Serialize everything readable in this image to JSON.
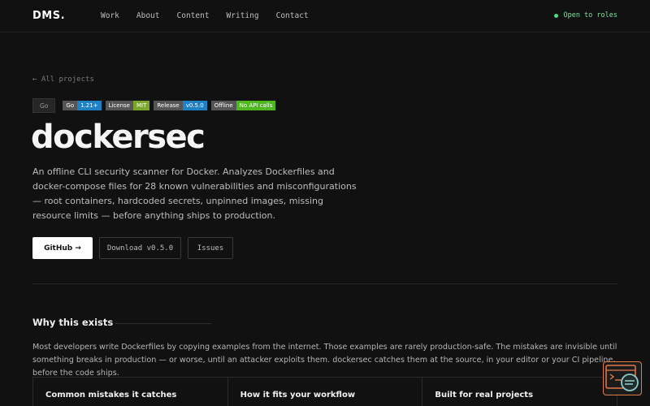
{
  "nav": {
    "logo": "DMS",
    "logo_dot": ".",
    "links": [
      "Work",
      "About",
      "Content",
      "Writing",
      "Contact"
    ],
    "status": "Open to roles"
  },
  "back_link": "← All projects",
  "badges": {
    "go_tag": "Go",
    "shields": [
      {
        "key": "Go",
        "value": "1.21+",
        "color": "#1f80c4"
      },
      {
        "key": "License",
        "value": "MIT",
        "color": "#7aa62c"
      },
      {
        "key": "Release",
        "value": "v0.5.0",
        "color": "#1f80c4"
      },
      {
        "key": "Offline",
        "value": "No API calls",
        "color": "#4fb81f"
      }
    ]
  },
  "title": "dockersec",
  "description": "An offline CLI security scanner for Docker. Analyzes Dockerfiles and docker-compose files for 28 known vulnerabilities and misconfigurations — root containers, hardcoded secrets, unpinned images, missing resource limits — before anything ships to production.",
  "buttons": {
    "github": "GitHub →",
    "download": "Download v0.5.0",
    "issues": "Issues"
  },
  "why": {
    "heading": "Why this exists",
    "body": "Most developers write Dockerfiles by copying examples from the internet. Those examples are rarely production-safe. The mistakes are invisible until something breaks in production — or worse, until an attacker exploits them. dockersec catches them at the source, in your editor or your CI pipeline, before the code ships."
  },
  "cards": [
    "Common mistakes it catches",
    "How it fits your workflow",
    "Built for real projects"
  ],
  "colors": {
    "accent_status": "#4ade80",
    "widget_border": "#e07b4a"
  }
}
